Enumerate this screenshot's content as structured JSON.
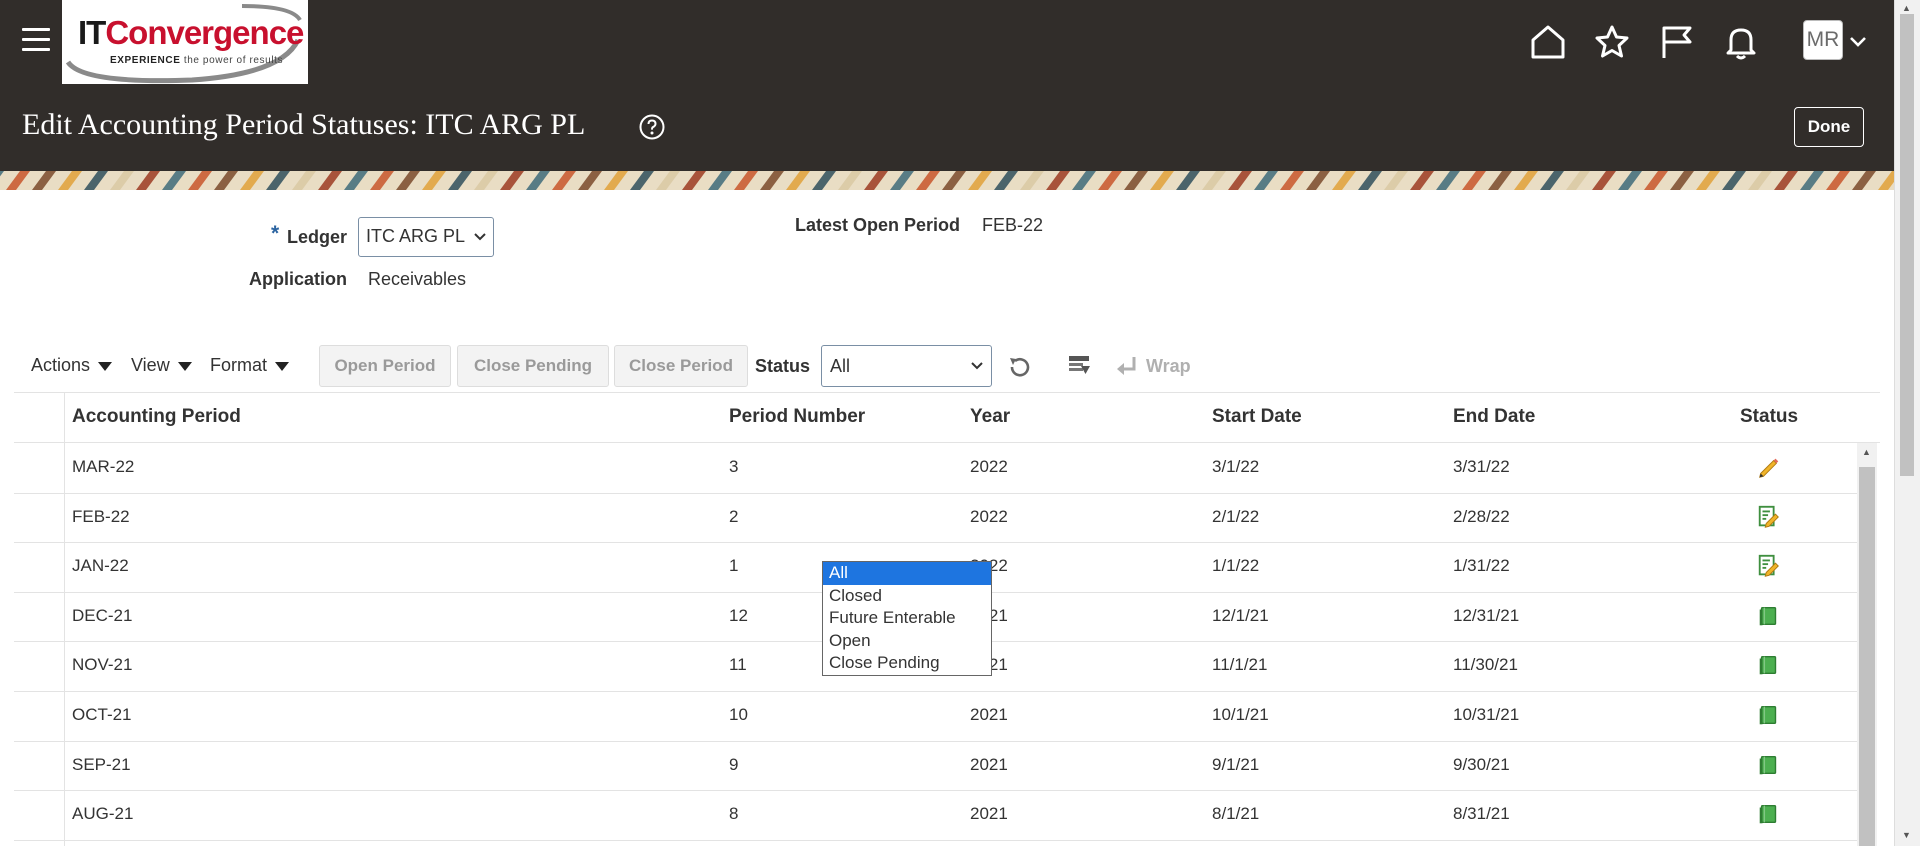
{
  "header": {
    "logo": {
      "brand_it": "IT",
      "brand_rest": "Convergence",
      "tagline_bold": "EXPERIENCE",
      "tagline_rest": " the power of results"
    },
    "page_title": "Edit Accounting Period Statuses: ITC ARG PL",
    "done_label": "Done",
    "avatar_initials": "MR",
    "icons": [
      "home-icon",
      "star-icon",
      "flag-icon",
      "bell-icon"
    ]
  },
  "form": {
    "required_marker": "*",
    "ledger_label": "Ledger",
    "ledger_value": "ITC ARG PL",
    "application_label": "Application",
    "application_value": "Receivables",
    "latest_open_label": "Latest Open Period",
    "latest_open_value": "FEB-22"
  },
  "toolbar": {
    "actions": "Actions",
    "view": "View",
    "format": "Format",
    "open_period": "Open Period",
    "close_pending": "Close Pending",
    "close_period": "Close Period",
    "status_label": "Status",
    "status_value": "All",
    "wrap": "Wrap"
  },
  "table": {
    "columns": [
      "Accounting Period",
      "Period Number",
      "Year",
      "Start Date",
      "End Date",
      "Status"
    ],
    "rows": [
      {
        "period": "MAR-22",
        "number": "3",
        "year": "2022",
        "start": "3/1/22",
        "end": "3/31/22",
        "status_icon": "pencil-icon"
      },
      {
        "period": "FEB-22",
        "number": "2",
        "year": "2022",
        "start": "2/1/22",
        "end": "2/28/22",
        "status_icon": "edit-document-icon"
      },
      {
        "period": "JAN-22",
        "number": "1",
        "year": "2022",
        "start": "1/1/22",
        "end": "1/31/22",
        "status_icon": "edit-document-icon"
      },
      {
        "period": "DEC-21",
        "number": "12",
        "year": "2021",
        "start": "12/1/21",
        "end": "12/31/21",
        "status_icon": "closed-book-icon"
      },
      {
        "period": "NOV-21",
        "number": "11",
        "year": "2021",
        "start": "11/1/21",
        "end": "11/30/21",
        "status_icon": "closed-book-icon"
      },
      {
        "period": "OCT-21",
        "number": "10",
        "year": "2021",
        "start": "10/1/21",
        "end": "10/31/21",
        "status_icon": "closed-book-icon"
      },
      {
        "period": "SEP-21",
        "number": "9",
        "year": "2021",
        "start": "9/1/21",
        "end": "9/30/21",
        "status_icon": "closed-book-icon"
      },
      {
        "period": "AUG-21",
        "number": "8",
        "year": "2021",
        "start": "8/1/21",
        "end": "8/31/21",
        "status_icon": "closed-book-icon"
      }
    ]
  },
  "status_dropdown": {
    "options": [
      "All",
      "Closed",
      "Future Enterable",
      "Open",
      "Close Pending"
    ],
    "selected": "All"
  },
  "colors": {
    "header_bg": "#312d2a",
    "selected_option": "#1e75e0",
    "required": "#2a63a0"
  }
}
